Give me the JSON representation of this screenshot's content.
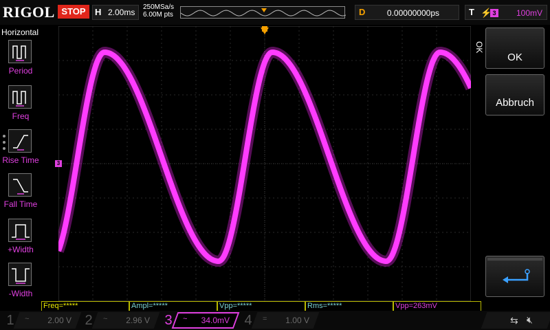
{
  "topbar": {
    "logo": "RIGOL",
    "run_state": "STOP",
    "timebase_label": "H",
    "timebase_value": "2.00ms",
    "sample_rate": "250MSa/s",
    "memory_depth": "6.00M pts",
    "delay_label": "D",
    "delay_value": "0.00000000ps",
    "trigger_label": "T",
    "trigger_source": "3",
    "trigger_level": "100mV"
  },
  "left_menu": {
    "title": "Horizontal",
    "items": [
      {
        "label": "Period",
        "icon": "period-icon"
      },
      {
        "label": "Freq",
        "icon": "freq-icon"
      },
      {
        "label": "Rise Time",
        "icon": "rise-time-icon"
      },
      {
        "label": "Fall Time",
        "icon": "fall-time-icon"
      },
      {
        "label": "+Width",
        "icon": "pos-width-icon"
      },
      {
        "label": "-Width",
        "icon": "neg-width-icon"
      }
    ]
  },
  "right_panel": {
    "side_label": "OK",
    "ok_label": "OK",
    "cancel_label": "Abbruch",
    "enter_icon": "enter-icon"
  },
  "measurements": [
    "Freq=*****",
    "Ampl=*****",
    "Vpp=*****",
    "Rms=*****",
    "Vpp=263mV"
  ],
  "channels": [
    {
      "num": "1",
      "coupling": "~",
      "scale": "2.00 V",
      "active": false
    },
    {
      "num": "2",
      "coupling": "~",
      "scale": "2.96 V",
      "active": false
    },
    {
      "num": "3",
      "coupling": "~",
      "scale": "34.0mV",
      "active": true
    },
    {
      "num": "4",
      "coupling": "=",
      "scale": "1.00 V",
      "active": false
    }
  ],
  "waveform": {
    "channel": "3",
    "color": "#ff28ff",
    "shape": "sine",
    "periods_visible": 2.15
  },
  "colors": {
    "ch3": "#e040e0",
    "stop": "#e0261b",
    "delay": "#f5a000",
    "trigger_marker": "#f5a000"
  }
}
